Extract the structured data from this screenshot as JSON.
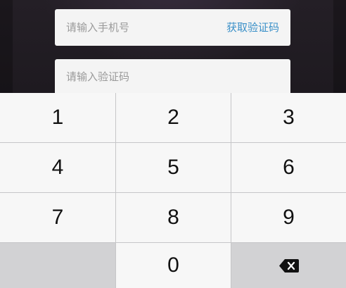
{
  "form": {
    "phone_placeholder": "请输入手机号",
    "get_code_label": "获取验证码",
    "code_placeholder": "请输入验证码"
  },
  "keypad": {
    "rows": [
      [
        "1",
        "2",
        "3"
      ],
      [
        "4",
        "5",
        "6"
      ],
      [
        "7",
        "8",
        "9"
      ],
      [
        "",
        "0",
        "⌫"
      ]
    ],
    "backspace_icon": "delete-left-icon"
  },
  "colors": {
    "link": "#3a90c8",
    "key": "#f7f7f7",
    "key_dark": "#d2d2d4",
    "separator": "#c6c6c8"
  }
}
